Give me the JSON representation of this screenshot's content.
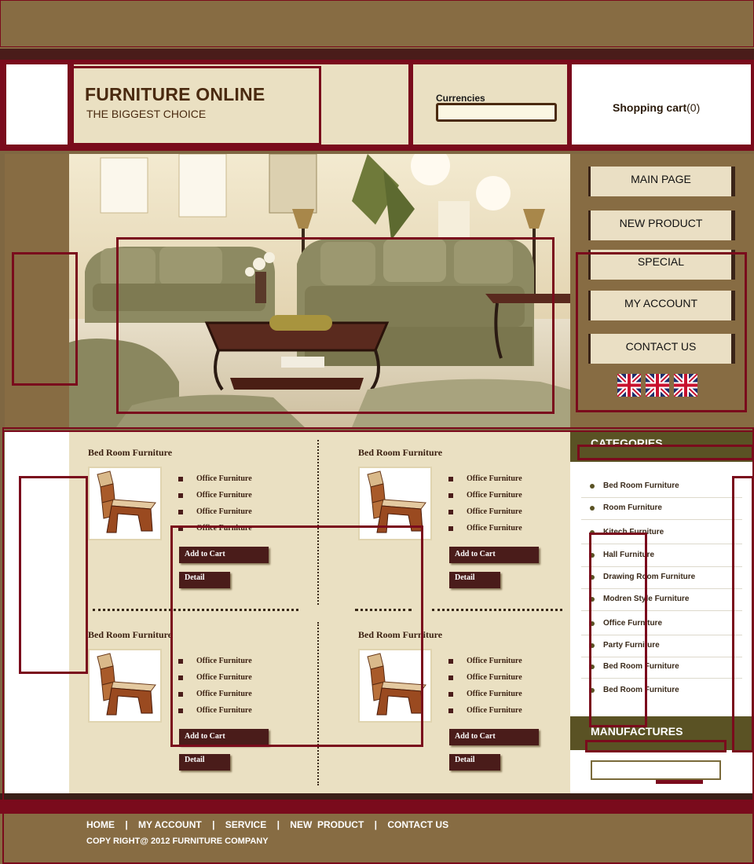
{
  "header": {
    "logo_title": "FURNITURE ONLINE",
    "logo_subtitle": "THE BIGGEST CHOICE",
    "currencies_label": "Currencies",
    "currencies_value": "",
    "cart_label": "Shopping cart",
    "cart_count": "(0)"
  },
  "nav": {
    "items": [
      {
        "label": "MAIN PAGE"
      },
      {
        "label": "NEW PRODUCT"
      },
      {
        "label": "SPECIAL"
      },
      {
        "label": "MY ACCOUNT"
      },
      {
        "label": "CONTACT US"
      }
    ],
    "flags": [
      "uk-flag-icon",
      "uk-flag-icon",
      "uk-flag-icon"
    ]
  },
  "products": [
    {
      "title": "Bed Room  Furniture",
      "items": [
        "Office Furniture",
        "Office Furniture",
        "Office Furniture",
        "Office Furniture"
      ],
      "add_to_cart": "Add to Cart",
      "detail": "Detail"
    },
    {
      "title": "Bed Room  Furniture",
      "items": [
        "Office Furniture",
        "Office Furniture",
        "Office Furniture",
        "Office Furniture"
      ],
      "add_to_cart": "Add to Cart",
      "detail": "Detail"
    },
    {
      "title": "Bed Room  Furniture",
      "items": [
        "Office Furniture",
        "Office Furniture",
        "Office Furniture",
        "Office Furniture"
      ],
      "add_to_cart": "Add to Cart",
      "detail": "Detail"
    },
    {
      "title": "Bed Room  Furniture",
      "items": [
        "Office Furniture",
        "Office Furniture",
        "Office Furniture",
        "Office Furniture"
      ],
      "add_to_cart": "Add to Cart",
      "detail": "Detail"
    }
  ],
  "sidebar": {
    "categories_title": "CATEGORIES",
    "categories": [
      {
        "label": "Bed Room Furniture"
      },
      {
        "label": "Room Furniture"
      },
      {
        "label": "Kitech Furniture"
      },
      {
        "label": "Hall Furniture"
      },
      {
        "label": "Drawing Room Furniture"
      },
      {
        "label": "Modren Style Furniture"
      },
      {
        "label": "Office Furniture"
      },
      {
        "label": "Party Furniture"
      },
      {
        "label": "Bed Room Furniture"
      },
      {
        "label": "Bed Room Furniture"
      }
    ],
    "manufactures_title": "MANUFACTURES",
    "manufactures_value": ""
  },
  "footer": {
    "links": [
      {
        "label": "HOME"
      },
      {
        "label": "MY ACCOUNT"
      },
      {
        "label": "SERVICE"
      },
      {
        "label": "NEW  PRODUCT"
      },
      {
        "label": "CONTACT US"
      }
    ],
    "separator": "|",
    "copyright": "COPY RIGHT@ 2012 FURNITURE COMPANY"
  },
  "colors": {
    "brand_brown": "#876c43",
    "accent_maroon": "#7a0b1c",
    "dark_button": "#4a1c1a",
    "cream": "#eae0c2",
    "olive_header": "#5a5224"
  }
}
